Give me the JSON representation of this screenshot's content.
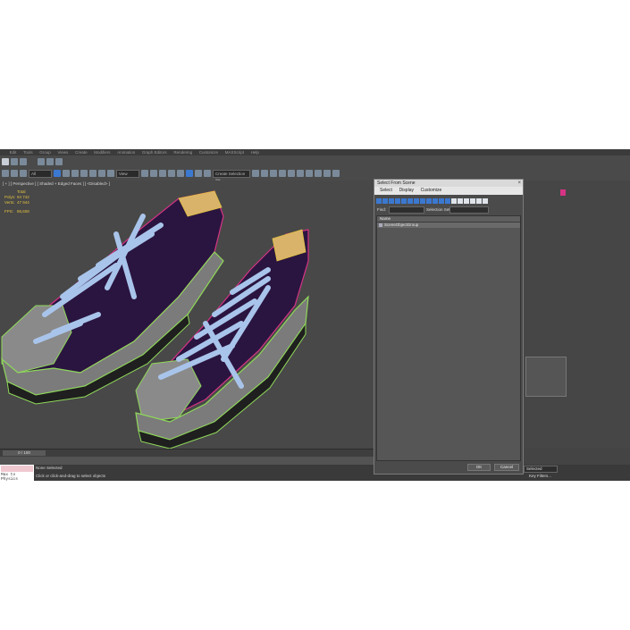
{
  "menu": [
    "",
    "Edit",
    "Tools",
    "Group",
    "Views",
    "Create",
    "Modifiers",
    "Animation",
    "Graph Editors",
    "Rendering",
    "Customize",
    "MAXScript",
    "Help"
  ],
  "toolbar": {
    "filter_dropdown": "All",
    "view_dropdown": "View",
    "selection_set_dropdown": "Create Selection Se"
  },
  "viewport": {
    "label": "[ + ] [ Perspective ] [ Shaded + Edged Faces ] [ <Disabled> ]",
    "stats": {
      "header": "Total",
      "polys_label": "Polys:",
      "polys_value": "94 742",
      "verts_label": "Verts:",
      "verts_value": "47 944",
      "fps_label": "FPS:",
      "fps_value": "86,608"
    }
  },
  "timeline": {
    "frame_counter": "0 / 100"
  },
  "status": {
    "maxscript_label": "Max to Physics",
    "selection": "None Selected",
    "prompt": "Click or click-and-drag to select objects",
    "right_dropdown": "Selected",
    "key_filters": "Key Filters..."
  },
  "dialog": {
    "title": "Select From Scene",
    "menu": [
      "Select",
      "Display",
      "Customize"
    ],
    "find_label": "Find:",
    "find_value": "",
    "selection_set_label": "Selection Set:",
    "selection_set_value": "",
    "column_header": "Name",
    "rows": [
      "SceneObjectGroup"
    ],
    "ok_label": "OK",
    "cancel_label": "Cancel"
  },
  "colors": {
    "app_bg": "#444444",
    "accent_blue": "#3b78d0",
    "stats_yellow": "#e0c040",
    "wire_green": "#8fd85a",
    "wire_magenta": "#d63384"
  }
}
